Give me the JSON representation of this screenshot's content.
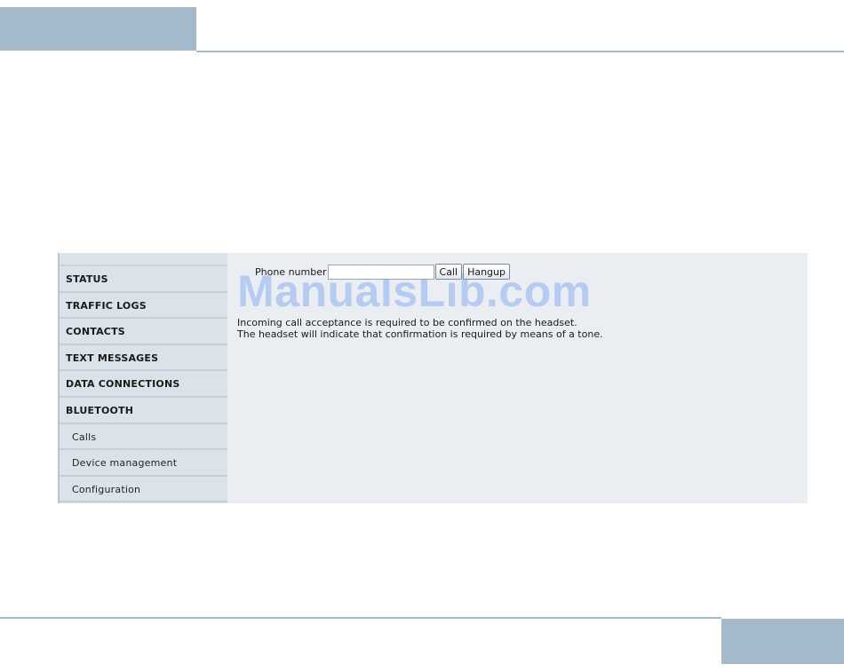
{
  "sidebar": {
    "items": [
      {
        "label": "STATUS"
      },
      {
        "label": "TRAFFIC LOGS"
      },
      {
        "label": "CONTACTS"
      },
      {
        "label": "TEXT MESSAGES"
      },
      {
        "label": "DATA CONNECTIONS"
      },
      {
        "label": "BLUETOOTH"
      },
      {
        "label": "Calls"
      },
      {
        "label": "Device management"
      },
      {
        "label": "Configuration"
      }
    ]
  },
  "call_form": {
    "phone_label": "Phone number",
    "phone_value": "",
    "call_label": "Call",
    "hangup_label": "Hangup"
  },
  "info": {
    "line1": "Incoming call acceptance is required to be confirmed on the headset.",
    "line2": "The headset will indicate that confirmation is required by means of a tone."
  },
  "watermark": {
    "text": "ManualsLib.com"
  },
  "colors": {
    "page_accent": "#a4b9c9",
    "sidebar_bg": "#dbe3ea",
    "content_bg": "#eaeef3"
  }
}
